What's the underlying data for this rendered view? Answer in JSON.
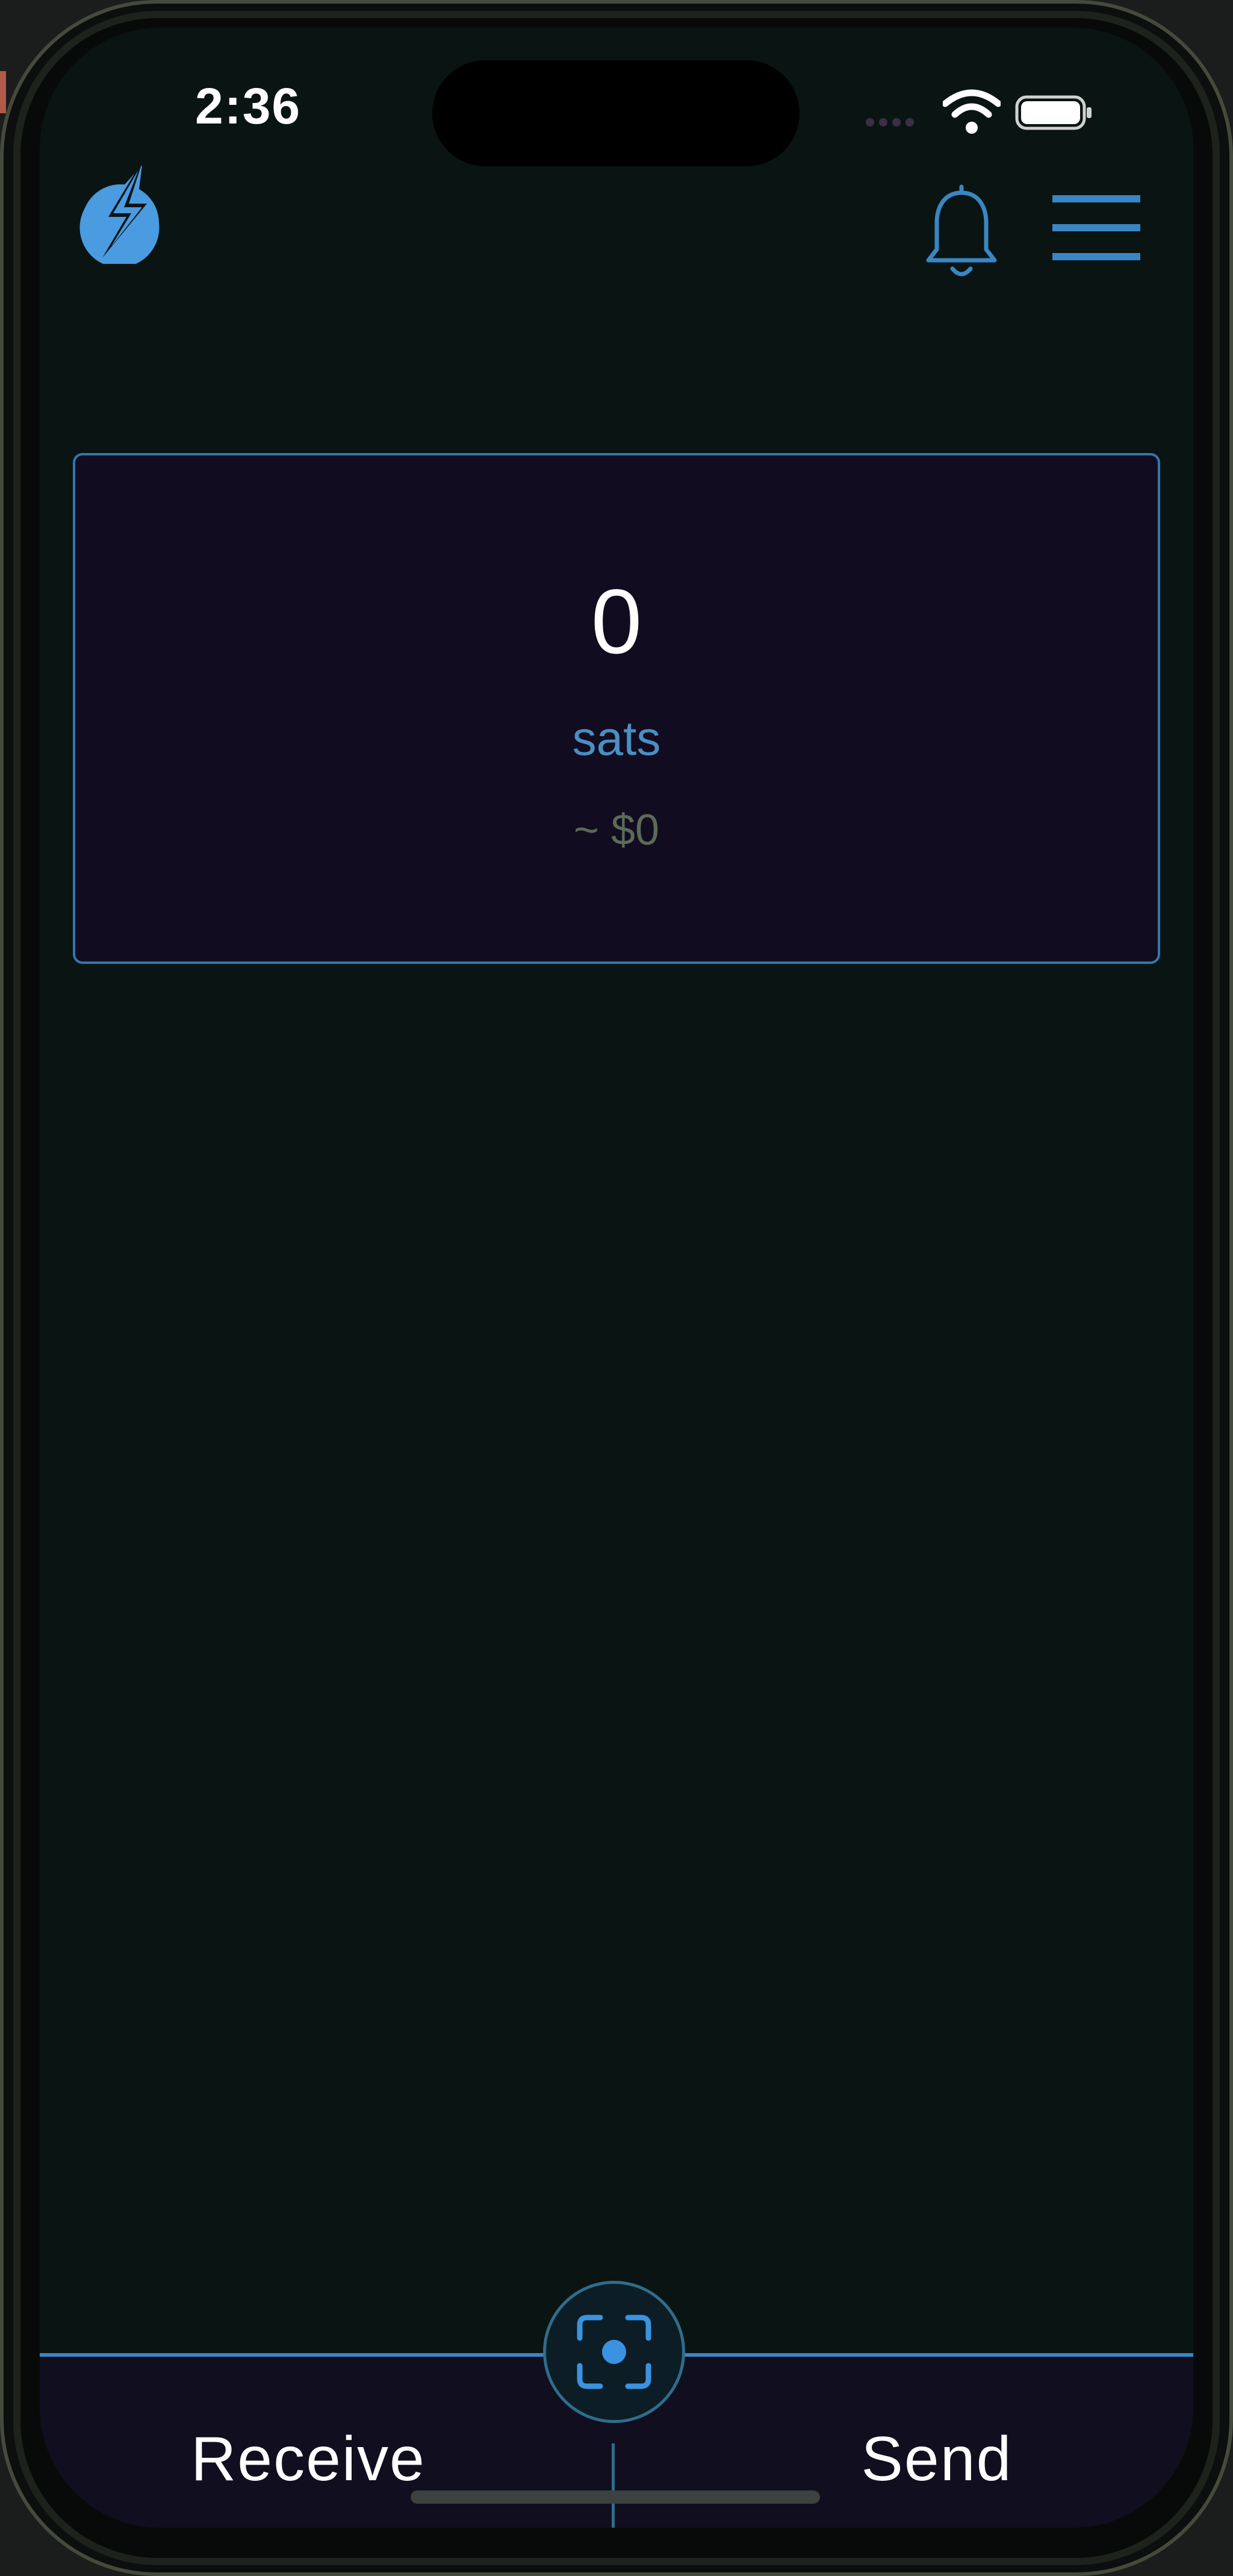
{
  "status_bar": {
    "time": "2:36"
  },
  "header": {
    "logo": "lightning-bolt-logo-icon",
    "notifications": "bell-icon",
    "menu": "hamburger-menu-icon"
  },
  "balance": {
    "amount": "0",
    "unit": "sats",
    "fiat": "~ $0"
  },
  "bottom_bar": {
    "receive_label": "Receive",
    "send_label": "Send",
    "scan": "scan-icon"
  },
  "colors": {
    "background": "#0a1413",
    "card_background": "#110c20",
    "accent": "#3a86c4",
    "unit_text": "#4a8fc4",
    "fiat_text": "#5a6b57"
  }
}
